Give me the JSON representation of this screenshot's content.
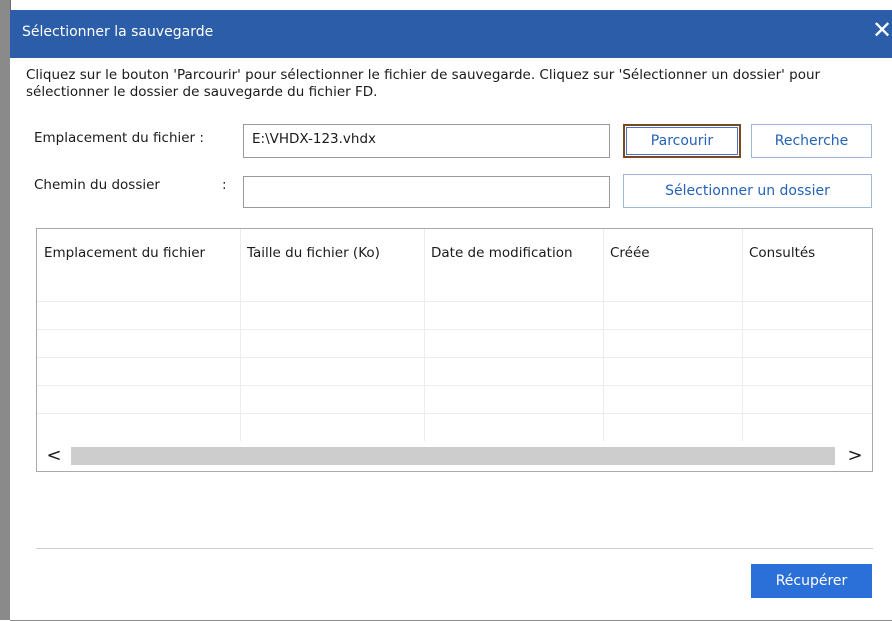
{
  "window": {
    "title": "Sélectionner la sauvegarde",
    "close_glyph": "✕"
  },
  "instructions": "Cliquez sur le bouton 'Parcourir' pour sélectionner le fichier de sauvegarde. Cliquez sur 'Sélectionner un dossier' pour sélectionner le dossier de sauvegarde du fichier FD.",
  "file_location": {
    "label": "Emplacement du fichier :",
    "value": "E:\\VHDX-123.vhdx"
  },
  "folder_path": {
    "label": "Chemin du dossier",
    "colon": ":",
    "value": ""
  },
  "buttons": {
    "browse": "Parcourir",
    "search": "Recherche",
    "select_folder": "Sélectionner un dossier",
    "recover": "Récupérer"
  },
  "table": {
    "columns": [
      "Emplacement du fichier",
      "Taille du fichier (Ko)",
      "Date de modification",
      "Créée",
      "Consultés"
    ],
    "rows": []
  },
  "scrollbar": {
    "left_arrow": "<",
    "right_arrow": ">"
  },
  "icons": {
    "close": "close-icon",
    "scroll_left": "chevron-left-icon",
    "scroll_right": "chevron-right-icon"
  },
  "colors": {
    "titlebar": "#2b5da8",
    "accent": "#2462b8",
    "primary_button": "#2b6fd8",
    "focus_border": "#7a4a1e"
  }
}
